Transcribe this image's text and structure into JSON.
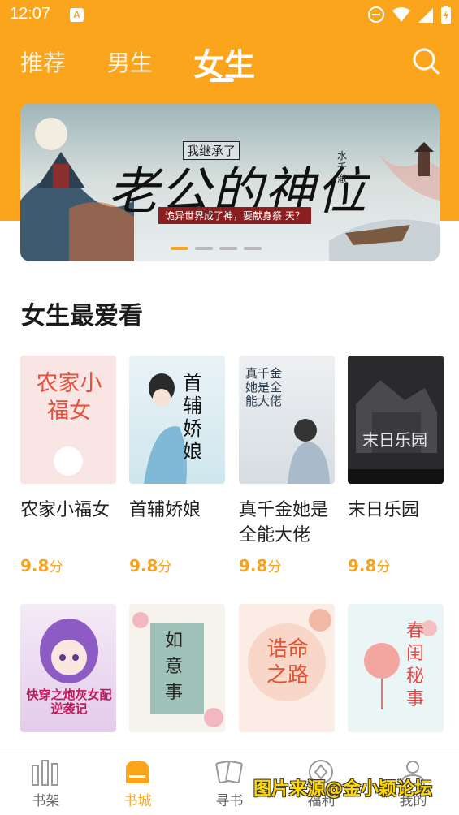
{
  "status_bar": {
    "time": "12:07",
    "app_icon": "A"
  },
  "header": {
    "tabs": [
      {
        "label": "推荐",
        "active": false
      },
      {
        "label": "男生",
        "active": false
      },
      {
        "label": "女生",
        "active": true
      }
    ],
    "search_icon": "search-icon"
  },
  "banner": {
    "eyebrow": "我继承了",
    "title": "老公的神位",
    "author": "水千澈",
    "tagline": "诡异世界成了神，要献身祭 天？",
    "indicator_count": 4,
    "indicator_active": 0
  },
  "section": {
    "title": "女生最爱看"
  },
  "books_row1": [
    {
      "name": "农家小福女",
      "score": "9.8",
      "unit": "分",
      "cover_text": "农家小福女"
    },
    {
      "name": "首辅娇娘",
      "score": "9.8",
      "unit": "分",
      "cover_text": "首辅娇娘"
    },
    {
      "name": "真千金她是全能大佬",
      "score": "9.8",
      "unit": "分",
      "cover_text": "真千金她是全能大佬"
    },
    {
      "name": "末日乐园",
      "score": "9.8",
      "unit": "分",
      "cover_text": "末日乐园"
    }
  ],
  "books_row2": [
    {
      "cover_text": "快穿之炮灰女配逆袭记"
    },
    {
      "cover_text": "如意事"
    },
    {
      "cover_text": "诰命之路"
    },
    {
      "cover_text": "春闺秘事"
    }
  ],
  "bottom_nav": [
    {
      "label": "书架",
      "icon": "bookshelf-icon",
      "active": false
    },
    {
      "label": "书城",
      "icon": "bookstore-icon",
      "active": true
    },
    {
      "label": "寻书",
      "icon": "find-book-icon",
      "active": false
    },
    {
      "label": "福利",
      "icon": "gift-icon",
      "active": false
    },
    {
      "label": "我的",
      "icon": "profile-icon",
      "active": false
    }
  ],
  "watermark": "图片来源@金小颖论坛",
  "colors": {
    "brand": "#FBA51C",
    "score": "#F7A21B"
  }
}
